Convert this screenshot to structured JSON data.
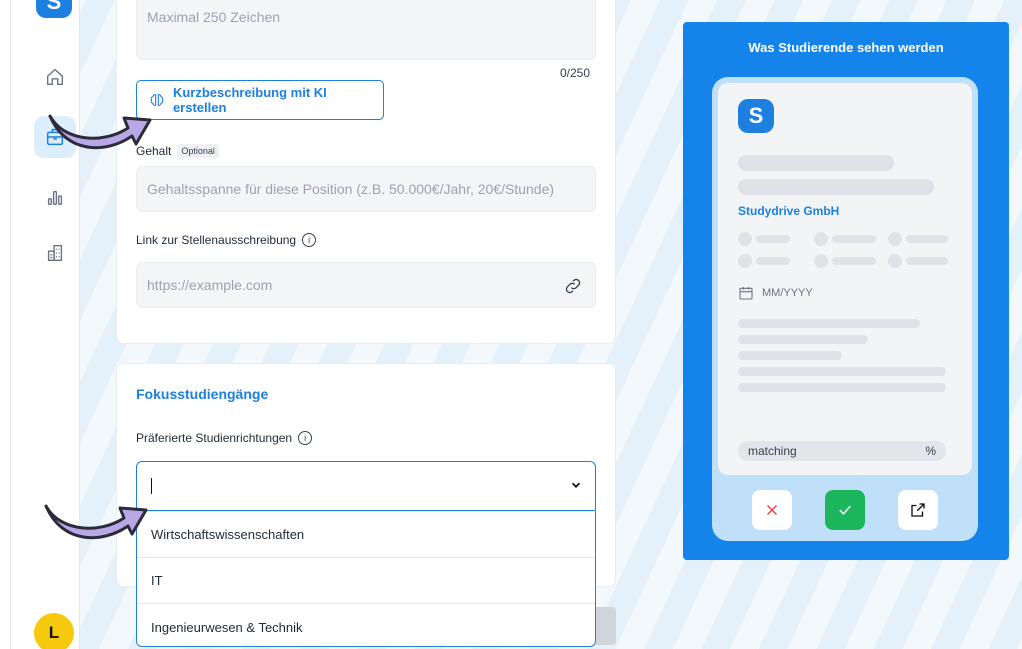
{
  "sidebar": {
    "logo": "S",
    "avatar": "L"
  },
  "description": {
    "placeholder": "Maximal 250 Zeichen",
    "counter": "0/250",
    "ai_button_label": "Kurzbeschreibung mit KI erstellen"
  },
  "salary": {
    "label": "Gehalt",
    "badge": "Optional",
    "placeholder": "Gehaltsspanne für diese Position (z.B. 50.000€/Jahr, 20€/Stunde)"
  },
  "link": {
    "label": "Link zur Stellenausschreibung",
    "placeholder": "https://example.com"
  },
  "focus": {
    "title": "Fokusstudiengänge",
    "label": "Präferierte Studienrichtungen",
    "select_value": "",
    "options": [
      "Wirtschaftswissenschaften",
      "IT",
      "Ingenieurwesen & Technik"
    ]
  },
  "preview": {
    "title": "Was Studierende sehen werden",
    "logo": "S",
    "company": "Studydrive GmbH",
    "date_placeholder": "MM/YYYY",
    "matching_label": "matching",
    "matching_unit": "%"
  },
  "colors": {
    "accent": "#1d7fe0",
    "preview_bg": "#1584ea",
    "avatar": "#f6c90e",
    "accept": "#1bb55c",
    "reject": "#e5484d"
  }
}
